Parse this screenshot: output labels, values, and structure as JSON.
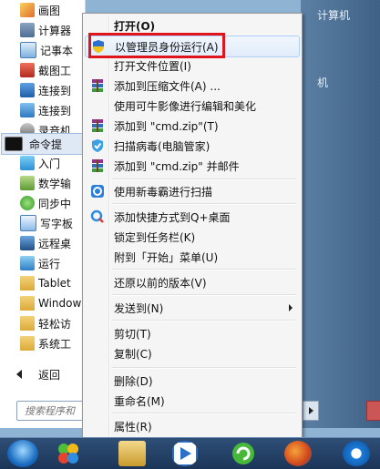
{
  "start_menu": {
    "programs": [
      {
        "label": "画图"
      },
      {
        "label": "计算器"
      },
      {
        "label": "记事本"
      },
      {
        "label": "截图工"
      },
      {
        "label": "连接到"
      },
      {
        "label": "连接到"
      },
      {
        "label": "录音机"
      },
      {
        "label": "命令提"
      },
      {
        "label": "入门"
      },
      {
        "label": "数学输"
      },
      {
        "label": "同步中"
      },
      {
        "label": "写字板"
      },
      {
        "label": "远程桌"
      },
      {
        "label": "运行"
      },
      {
        "label": "Tablet"
      },
      {
        "label": "Window"
      },
      {
        "label": "轻松访"
      },
      {
        "label": "系统工"
      }
    ],
    "back_label": "返回",
    "search_placeholder": "搜索程序和"
  },
  "right_pane": {
    "item_top": "计算机",
    "item_mid": "机"
  },
  "context_menu": {
    "items": [
      {
        "label": "打开(O)",
        "icon": "none"
      },
      {
        "label": "以管理员身份运行(A)",
        "icon": "uac-shield-icon"
      },
      {
        "label": "打开文件位置(I)",
        "icon": "none"
      },
      {
        "label": "添加到压缩文件(A) ...",
        "icon": "winrar-icon"
      },
      {
        "label": "使用可牛影像进行编辑和美化",
        "icon": "none"
      },
      {
        "label": "添加到 \"cmd.zip\"(T)",
        "icon": "winrar-icon"
      },
      {
        "label": "扫描病毒(电脑管家)",
        "icon": "pc-manager-shield-icon"
      },
      {
        "label": "添加到 \"cmd.zip\" 并邮件",
        "icon": "winrar-icon"
      },
      {
        "label": "使用新毒霸进行扫描",
        "icon": "duba-icon"
      },
      {
        "label": "添加快捷方式到Q+桌面",
        "icon": "qplus-icon"
      },
      {
        "label": "锁定到任务栏(K)",
        "icon": "none"
      },
      {
        "label": "附到「开始」菜单(U)",
        "icon": "none"
      },
      {
        "label": "还原以前的版本(V)",
        "icon": "none"
      },
      {
        "label": "发送到(N)",
        "icon": "none"
      },
      {
        "label": "剪切(T)",
        "icon": "none"
      },
      {
        "label": "复制(C)",
        "icon": "none"
      },
      {
        "label": "删除(D)",
        "icon": "none"
      },
      {
        "label": "重命名(M)",
        "icon": "none"
      },
      {
        "label": "属性(R)",
        "icon": "none"
      }
    ]
  },
  "taskbar": {
    "icons": [
      "start-orb-icon",
      "app-clover-icon",
      "file-manager-icon",
      "media-player-icon",
      "refresh-app-icon",
      "firefox-icon",
      "sogou-icon"
    ]
  },
  "colors": {
    "highlight_border": "#e0141b",
    "menu_bg": "#f5f5f5",
    "taskbar": "#1b3558"
  }
}
